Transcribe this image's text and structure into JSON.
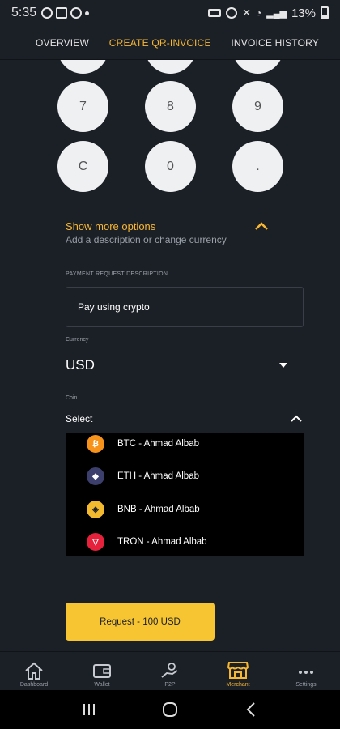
{
  "status_bar": {
    "time": "5:35",
    "battery": "13%"
  },
  "tabs": [
    {
      "label": "OVERVIEW",
      "active": false
    },
    {
      "label": "CREATE QR-INVOICE",
      "active": true
    },
    {
      "label": "INVOICE HISTORY",
      "active": false
    }
  ],
  "keypad": {
    "row_partial": [
      "",
      "",
      ""
    ],
    "row3": [
      "7",
      "8",
      "9"
    ],
    "row4": [
      "C",
      "0",
      "."
    ]
  },
  "options": {
    "title": "Show more options",
    "subtitle": "Add a description or change currency"
  },
  "description": {
    "label": "PAYMENT REQUEST DESCRIPTION",
    "value": "Pay using crypto"
  },
  "currency": {
    "label": "Currency",
    "value": "USD"
  },
  "coin": {
    "label": "Coin",
    "value": "Select",
    "options": [
      {
        "label": "BTC - Ahmad Albab",
        "icon": "btc-icon",
        "color": "#f7931a"
      },
      {
        "label": "ETH - Ahmad Albab",
        "icon": "eth-icon",
        "color": "#3c3f6b"
      },
      {
        "label": "BNB - Ahmad Albab",
        "icon": "bnb-icon",
        "color": "#f3ba2f"
      },
      {
        "label": "TRON - Ahmad Albab",
        "icon": "tron-icon",
        "color": "#e5213b"
      }
    ]
  },
  "request_button": {
    "label": "Request - 100 USD"
  },
  "bottom_nav": [
    {
      "label": "Dashboard",
      "icon": "home-icon",
      "active": false
    },
    {
      "label": "Wallet",
      "icon": "wallet-icon",
      "active": false
    },
    {
      "label": "P2P",
      "icon": "p2p-icon",
      "active": false
    },
    {
      "label": "Merchant",
      "icon": "store-icon",
      "active": true
    },
    {
      "label": "Settings",
      "icon": "more-icon",
      "active": false
    }
  ],
  "colors": {
    "accent": "#f7b731",
    "background": "#1b1f26",
    "button": "#f7c532"
  }
}
